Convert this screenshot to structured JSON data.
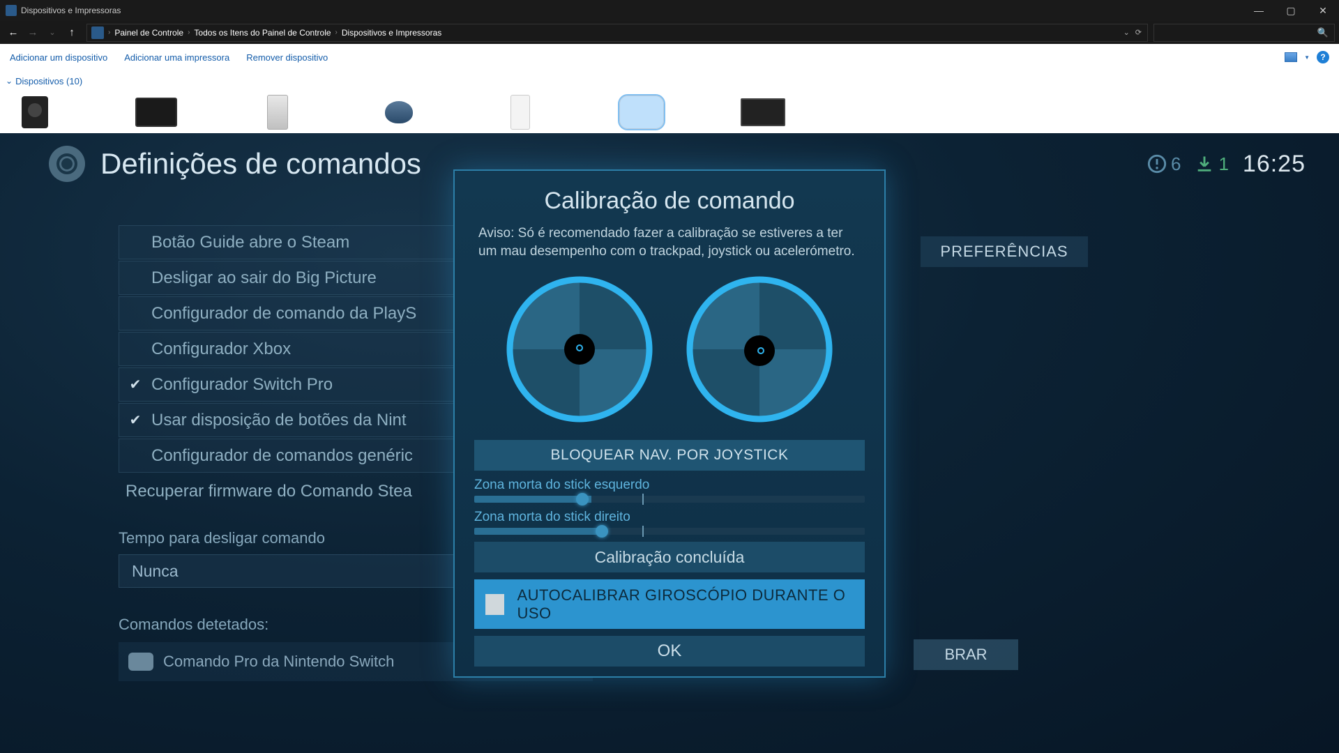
{
  "window": {
    "title": "Dispositivos e Impressoras",
    "minimize": "—",
    "maximize": "▢",
    "close": "✕"
  },
  "nav": {
    "back": "←",
    "forward": "→",
    "up": "↑",
    "dropdown": "⌄",
    "refresh": "⟳",
    "search_glyph": "🔍"
  },
  "breadcrumbs": [
    "Painel de Controle",
    "Todos os Itens do Painel de Controle",
    "Dispositivos e Impressoras"
  ],
  "toolbar": {
    "add_device": "Adicionar um dispositivo",
    "add_printer": "Adicionar uma impressora",
    "remove_device": "Remover dispositivo",
    "help": "?"
  },
  "category": {
    "chevron": "⌄",
    "label": "Dispositivos (10)"
  },
  "steam": {
    "title": "Definições de comandos",
    "alert_count": "6",
    "download_count": "1",
    "clock": "16:25",
    "prefs_btn": "PREFERÊNCIAS",
    "calibrate_btn": "BRAR",
    "settings": [
      {
        "label": "Botão Guide abre o Steam",
        "checked": false
      },
      {
        "label": "Desligar ao sair do Big Picture",
        "checked": false
      },
      {
        "label": "Configurador de comando da PlayS",
        "checked": false
      },
      {
        "label": "Configurador Xbox",
        "checked": false
      },
      {
        "label": "Configurador Switch Pro",
        "checked": true
      },
      {
        "label": "Usar disposição de botões da Nint",
        "checked": true
      },
      {
        "label": "Configurador de comandos genéric",
        "checked": false
      }
    ],
    "firmware_row": "Recuperar firmware do Comando Stea",
    "timeout_label": "Tempo para desligar comando",
    "timeout_value": "Nunca",
    "detected_label": "Comandos detetados:",
    "detected_value": "Comando Pro da Nintendo Switch"
  },
  "modal": {
    "title": "Calibração de comando",
    "warning": "Aviso: Só é recomendado fazer a calibração se estiveres a ter um mau desempenho com o trackpad, joystick ou acelerómetro.",
    "lock_nav": "BLOQUEAR NAV. POR JOYSTICK",
    "left_deadzone_label": "Zona morta do stick esquerdo",
    "right_deadzone_label": "Zona morta do stick direito",
    "status": "Calibração concluída",
    "autocal": "AUTOCALIBRAR GIROSCÓPIO DURANTE O USO",
    "ok": "OK"
  }
}
